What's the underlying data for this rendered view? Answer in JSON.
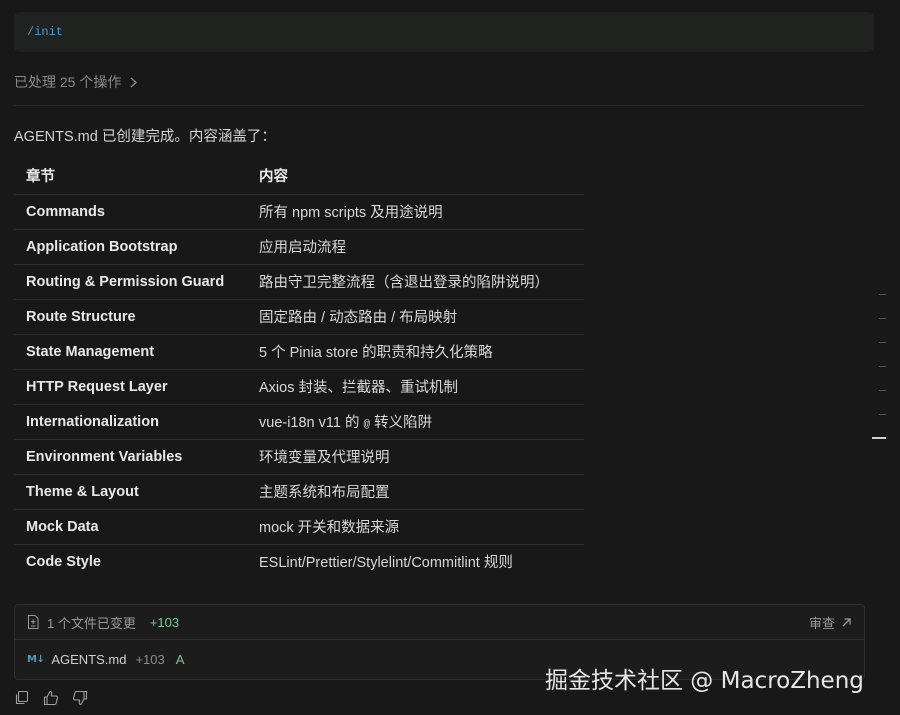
{
  "command": {
    "text": "/init"
  },
  "operations": {
    "label": "已处理 25 个操作"
  },
  "message": {
    "summary": "AGENTS.md 已创建完成。内容涵盖了："
  },
  "table": {
    "headers": {
      "section": "章节",
      "content": "内容"
    },
    "rows": [
      {
        "section": "Commands",
        "content": "所有 npm scripts 及用途说明"
      },
      {
        "section": "Application Bootstrap",
        "content": "应用启动流程"
      },
      {
        "section": "Routing & Permission Guard",
        "content": "路由守卫完整流程（含退出登录的陷阱说明）"
      },
      {
        "section": "Route Structure",
        "content": "固定路由 / 动态路由 / 布局映射"
      },
      {
        "section": "State Management",
        "content": "5 个 Pinia store 的职责和持久化策略"
      },
      {
        "section": "HTTP Request Layer",
        "content": "Axios 封装、拦截器、重试机制"
      },
      {
        "section": "Internationalization",
        "content_before": "vue-i18n v11 的 ",
        "content_code": "@",
        "content_after": " 转义陷阱"
      },
      {
        "section": "Environment Variables",
        "content": "环境变量及代理说明"
      },
      {
        "section": "Theme & Layout",
        "content": "主题系统和布局配置"
      },
      {
        "section": "Mock Data",
        "content": "mock 开关和数据来源"
      },
      {
        "section": "Code Style",
        "content": "ESLint/Prettier/Stylelint/Commitlint 规则"
      }
    ]
  },
  "changes": {
    "summary": "1 个文件已变更",
    "additions": "+103",
    "review_label": "审查",
    "file": {
      "badge": "M↓",
      "name": "AGENTS.md",
      "additions": "+103",
      "status": "A"
    }
  },
  "actions": {
    "icons": [
      "copy-icon",
      "thumbs-up-icon",
      "thumbs-down-icon"
    ]
  },
  "watermark": "掘金技术社区 @ MacroZheng",
  "colors": {
    "background": "#181818",
    "accent_blue": "#4d9bd1",
    "added_green": "#73c991",
    "md_badge_blue": "#519aba"
  }
}
